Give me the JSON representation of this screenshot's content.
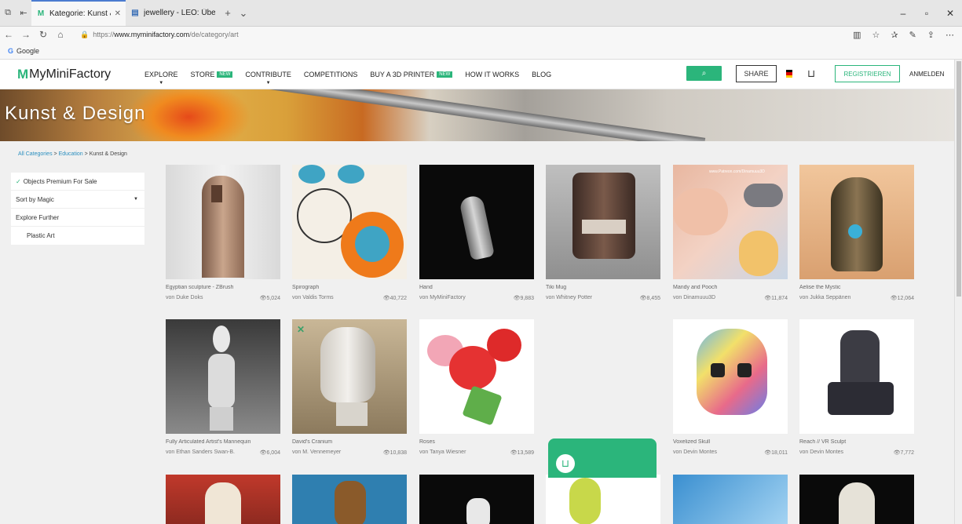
{
  "browser": {
    "tabs": [
      {
        "label": "Kategorie: Kunst & Desi",
        "icon": "M"
      },
      {
        "label": "jewellery - LEO: Übersetzun",
        "icon": "▤"
      }
    ],
    "url_prefix": "https://",
    "url_host": "www.myminifactory.com",
    "url_path": "/de/category/art",
    "favorite": "Google"
  },
  "header": {
    "logo_mark": "M",
    "logo_text": "MyMiniFactory",
    "nav": {
      "explore": "EXPLORE",
      "store": "STORE",
      "store_badge": "NEW",
      "contribute": "CONTRIBUTE",
      "competitions": "COMPETITIONS",
      "buy_printer": "BUY A 3D PRINTER",
      "buy_badge": "NEW",
      "how": "HOW IT WORKS",
      "blog": "BLOG"
    },
    "share": "SHARE",
    "register": "REGISTRIEREN",
    "login": "ANMELDEN"
  },
  "hero": {
    "title": "Kunst & Design"
  },
  "breadcrumb": {
    "all": "All Categories",
    "sep": " > ",
    "education": "Education",
    "current": "Kunst & Design"
  },
  "sidebar": {
    "premium": "Objects Premium For Sale",
    "sort": "Sort by Magic",
    "explore": "Explore Further",
    "sub": "Plastic Art"
  },
  "items": [
    {
      "title": "Egyptian sculpture - ZBrush",
      "author": "von Duke Doks",
      "views": "5,024"
    },
    {
      "title": "Spirograph",
      "author": "von Valdis Torms",
      "views": "40,722"
    },
    {
      "title": "Hand",
      "author": "von MyMiniFactory",
      "views": "9,883"
    },
    {
      "title": "Tiki Mug",
      "author": "von Whitney Potter",
      "views": "8,455"
    },
    {
      "title": "Mandy and Pooch",
      "author": "von Dinamuuu3D",
      "views": "11,874"
    },
    {
      "title": "Aelise the Mystic",
      "author": "von Jukka Seppänen",
      "views": "12,064"
    },
    {
      "title": "Fully Articulated Artist's Mannequin",
      "author": "von Ethan Sanders Swan-B.",
      "views": "6,004"
    },
    {
      "title": "David's Cranium",
      "author": "von M. Vennemeyer",
      "views": "10,838"
    },
    {
      "title": "Roses",
      "author": "von Tanya Wiesner",
      "views": "13,589"
    },
    {
      "title": "Voxelized Skull",
      "author": "von Devin Montes",
      "views": "18,011"
    },
    {
      "title": "Reach // VR Sculpt",
      "author": "von Devin Montes",
      "views": "7,772"
    }
  ],
  "watermark": "www.Patreon.com/Dinamuuu3D"
}
